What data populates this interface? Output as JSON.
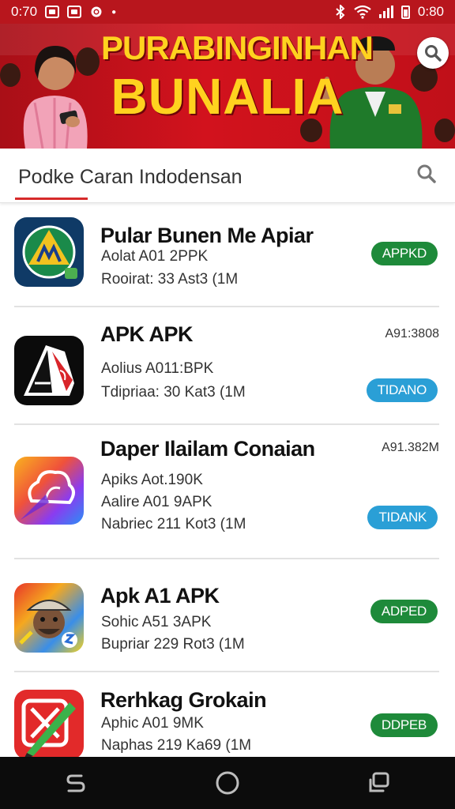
{
  "status_bar": {
    "time_left": "0:70",
    "time_right": "0:80"
  },
  "banner": {
    "line1": "PURABINGINHAN",
    "line2": "BUNALIA",
    "colors": {
      "background": "#c8121b",
      "title": "#ffd21f"
    },
    "search_icon": "search-icon"
  },
  "search": {
    "text": "Podke Caran Indodensan",
    "icon": "search-icon",
    "underline_color": "#d62a2a"
  },
  "apps": [
    {
      "name": "Pular Bunen Me Apiar",
      "line1": "Aolat A01 2PPK",
      "line2": "Rooirat: 33  Ast3 (1M",
      "side": "",
      "button": "APPKD",
      "button_color": "#1e8a3a",
      "icon": "shield-logo-icon"
    },
    {
      "name": "APK APK",
      "line1": "Aolius A011:BPK",
      "line2": "Tdipriaa: 30  Kat3 (1M",
      "side": "A91:3808",
      "button": "TIDANO",
      "button_color": "#2a9fd6",
      "icon": "letter-a-icon"
    },
    {
      "name": "Daper Ilailam Conaian",
      "line1": "Apiks Aot.190K",
      "line2": "Aalire A01 9APK",
      "line3": "Nabriec 211  Kot3 (1M",
      "side": "A91.382M",
      "button": "TIDANK",
      "button_color": "#2a9fd6",
      "icon": "cloud-icon"
    },
    {
      "name": "Apk A1 APK",
      "line1": "Sohic A51 3APK",
      "line2": "Bupriar 229  Rot3 (1M",
      "side": "",
      "button": "ADPED",
      "button_color": "#1e8a3a",
      "icon": "character-game-icon"
    },
    {
      "name": "Rerhkag Grokain",
      "line1": "Aphic A01 9MK",
      "line2": "Naphas 219  Ka69 (1M",
      "side": "",
      "button": "DDPEB",
      "button_color": "#1e8a3a",
      "icon": "pen-app-icon"
    }
  ],
  "navbar": {
    "back": "back-icon",
    "home": "home-icon",
    "recents": "recents-icon"
  }
}
